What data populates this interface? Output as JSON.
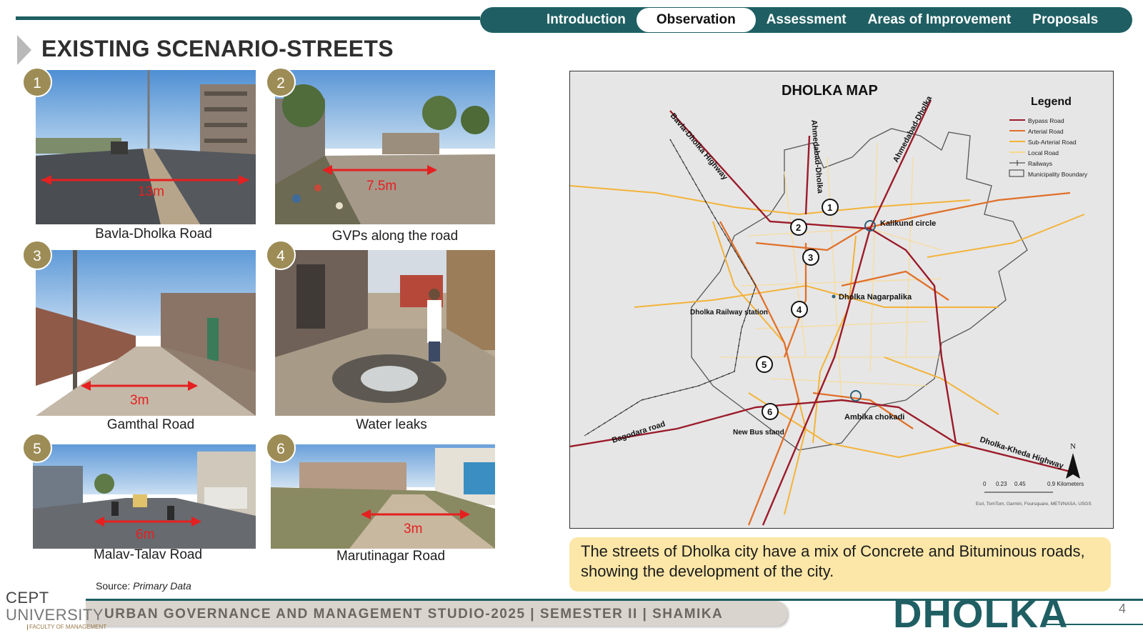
{
  "nav": {
    "tabs": [
      "Introduction",
      "Observation",
      "Assessment",
      "Areas of Improvement",
      "Proposals"
    ],
    "active": "Observation"
  },
  "title": "EXISTING SCENARIO-STREETS",
  "photos": [
    {
      "number": "1",
      "caption": "Bavla-Dholka Road",
      "width_label": "13m"
    },
    {
      "number": "2",
      "caption": "GVPs along the road",
      "width_label": "7.5m"
    },
    {
      "number": "3",
      "caption": "Gamthal Road",
      "width_label": "3m"
    },
    {
      "number": "4",
      "caption": "Water leaks",
      "width_label": ""
    },
    {
      "number": "5",
      "caption": "Malav-Talav Road",
      "width_label": "6m"
    },
    {
      "number": "6",
      "caption": "Marutinagar Road",
      "width_label": "3m"
    }
  ],
  "source": {
    "label": "Source:",
    "value": "Primary Data"
  },
  "map": {
    "title": "DHOLKA MAP",
    "legend_title": "Legend",
    "legend": [
      "Bypass Road",
      "Arterial Road",
      "Sub-Arterial Road",
      "Local Road",
      "Railways",
      "Municipality Boundary"
    ],
    "road_labels": [
      "Bavla-Dholka Highway",
      "Ahmedabad-Dholka",
      "Ahmedabad-Dholka",
      "Bagodara road",
      "Dholka-Kheda Highway"
    ],
    "places": [
      "Kalikund circle",
      "Dholka Nagarpalika",
      "Dholka Railway station",
      "Ambika chokadi",
      "New Bus stand"
    ],
    "markers": [
      "1",
      "2",
      "3",
      "4",
      "5",
      "6"
    ],
    "north": "N",
    "scale": [
      "0",
      "0.23",
      "0.45",
      "0.9 Kilometers"
    ],
    "attribution": "Esri, TomTom, Garmin, Foursquare, METI/NASA, USGS",
    "colors": {
      "bypass": "#9b1b2a",
      "arterial": "#e0702a",
      "sub_arterial": "#f3b33a",
      "local": "#f6d98a"
    }
  },
  "note": "The streets of Dholka city have a mix of Concrete and Bituminous roads, showing the development of the city.",
  "footer": {
    "text": "URBAN GOVERNANCE AND MANAGEMENT STUDIO-2025 | SEMESTER II | SHAMIKA",
    "brand": "DHOLKA",
    "page": "4",
    "logo_line1": "CEPT",
    "logo_line2": "UNIVERSITY",
    "logo_line3": "FACULTY OF MANAGEMENT"
  }
}
